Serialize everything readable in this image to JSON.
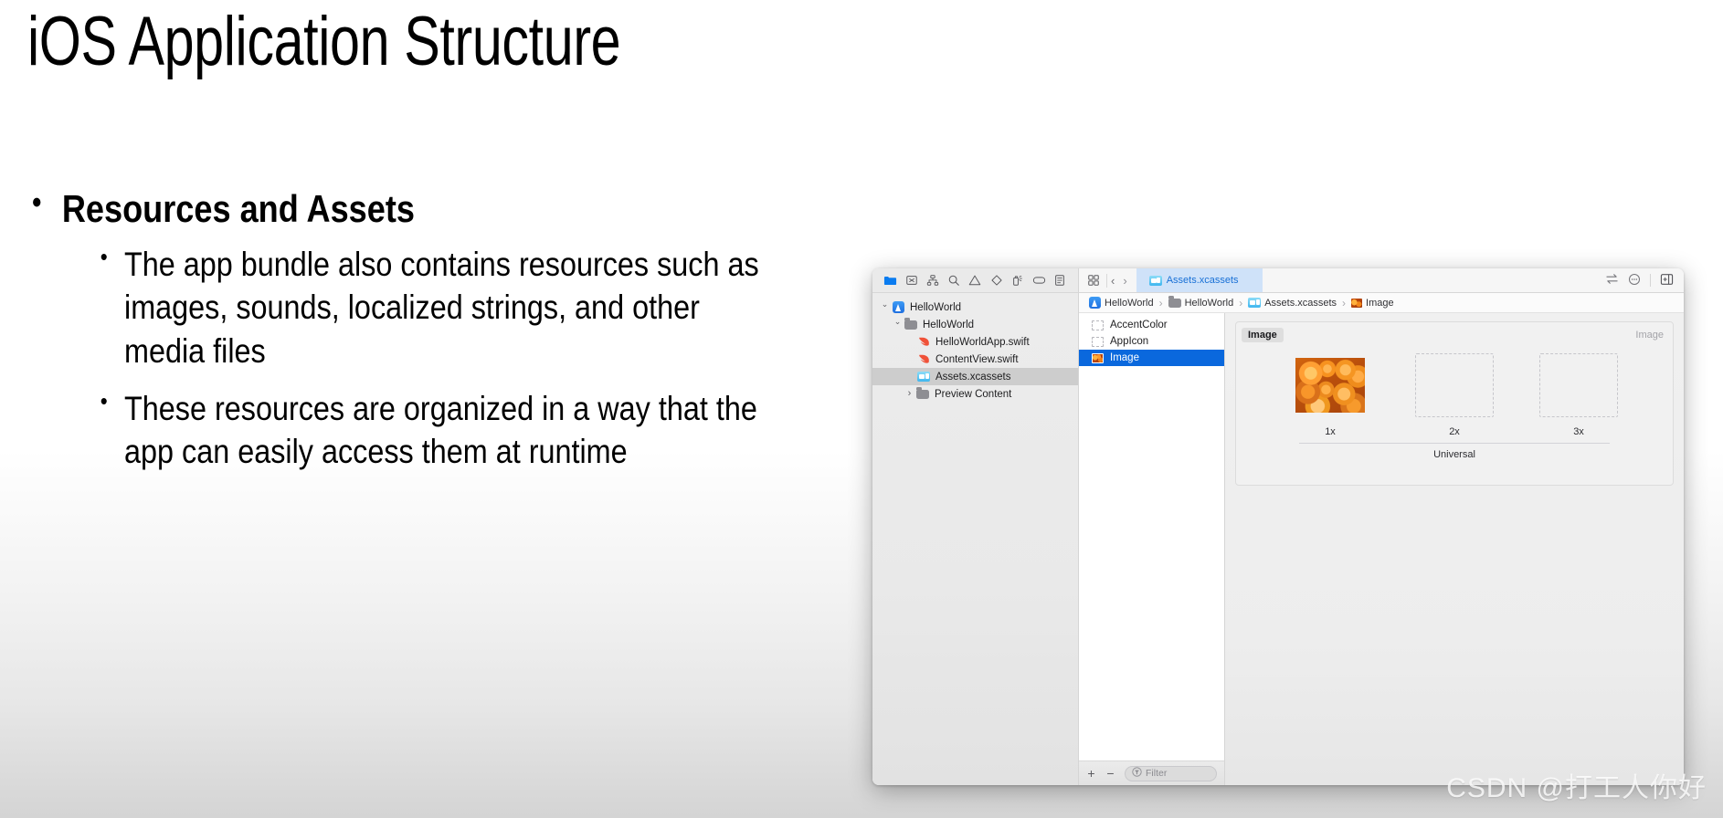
{
  "slide": {
    "title": "iOS Application Structure",
    "bullets": [
      {
        "level1": "Resources and Assets",
        "level2": [
          "The app bundle also contains resources such as images, sounds, localized strings, and other media files",
          "These resources are organized in a way that the app can easily access them at runtime"
        ]
      }
    ]
  },
  "watermark": "CSDN @打工人你好",
  "xcode": {
    "navigator_toolbar": [
      {
        "icon": "folder-icon",
        "active": true
      },
      {
        "icon": "source-control-icon",
        "active": false
      },
      {
        "icon": "symbol-hierarchy-icon",
        "active": false
      },
      {
        "icon": "search-icon",
        "active": false
      },
      {
        "icon": "warning-triangle-icon",
        "active": false
      },
      {
        "icon": "test-diamond-icon",
        "active": false
      },
      {
        "icon": "debug-spray-icon",
        "active": false
      },
      {
        "icon": "breakpoint-capsule-icon",
        "active": false
      },
      {
        "icon": "report-list-icon",
        "active": false
      }
    ],
    "editor_toolbar": {
      "grid_icon": "tab-grid-icon",
      "back_arrow": "‹",
      "forward_arrow": "›",
      "tab_label": "Assets.xcassets",
      "tab_icon": "assets-icon",
      "right_icons": [
        "swap-arrows-icon",
        "more-circle-icon",
        "inspector-panel-icon"
      ]
    },
    "navigator_tree": [
      {
        "label": "HelloWorld",
        "icon": "xcode-project-icon",
        "indent": 0,
        "twisty": "down",
        "selected": false
      },
      {
        "label": "HelloWorld",
        "icon": "folder-icon",
        "indent": 1,
        "twisty": "down",
        "selected": false
      },
      {
        "label": "HelloWorldApp.swift",
        "icon": "swift-file-icon",
        "indent": 2,
        "twisty": "none",
        "selected": false
      },
      {
        "label": "ContentView.swift",
        "icon": "swift-file-icon",
        "indent": 2,
        "twisty": "none",
        "selected": false
      },
      {
        "label": "Assets.xcassets",
        "icon": "assets-icon",
        "indent": 2,
        "twisty": "none",
        "selected": true
      },
      {
        "label": "Preview Content",
        "icon": "folder-icon",
        "indent": 1,
        "twisty": "right",
        "selected": false
      }
    ],
    "breadcrumb": [
      {
        "label": "HelloWorld",
        "icon": "xcode-project-icon"
      },
      {
        "label": "HelloWorld",
        "icon": "folder-icon"
      },
      {
        "label": "Assets.xcassets",
        "icon": "assets-icon"
      },
      {
        "label": "Image",
        "icon": "image-asset-icon"
      }
    ],
    "asset_list": [
      {
        "label": "AccentColor",
        "icon": "empty-swatch-icon",
        "selected": false
      },
      {
        "label": "AppIcon",
        "icon": "empty-swatch-icon",
        "selected": false
      },
      {
        "label": "Image",
        "icon": "image-asset-icon",
        "selected": true
      }
    ],
    "asset_bottom_bar": {
      "add_label": "+",
      "remove_label": "−",
      "filter_placeholder": "Filter",
      "filter_icon": "funnel-icon"
    },
    "detail": {
      "title": "Image",
      "kind": "Image",
      "slots": [
        {
          "scale": "1x",
          "filled": true
        },
        {
          "scale": "2x",
          "filled": false
        },
        {
          "scale": "3x",
          "filled": false
        }
      ],
      "device_class": "Universal"
    }
  },
  "colors": {
    "selection_blue": "#0a68dd",
    "tab_blue_bg": "#cfe2f9",
    "tab_blue_text": "#1870d6",
    "swift_orange": "#f05138",
    "xcode_blue": "#1f6fe0"
  }
}
